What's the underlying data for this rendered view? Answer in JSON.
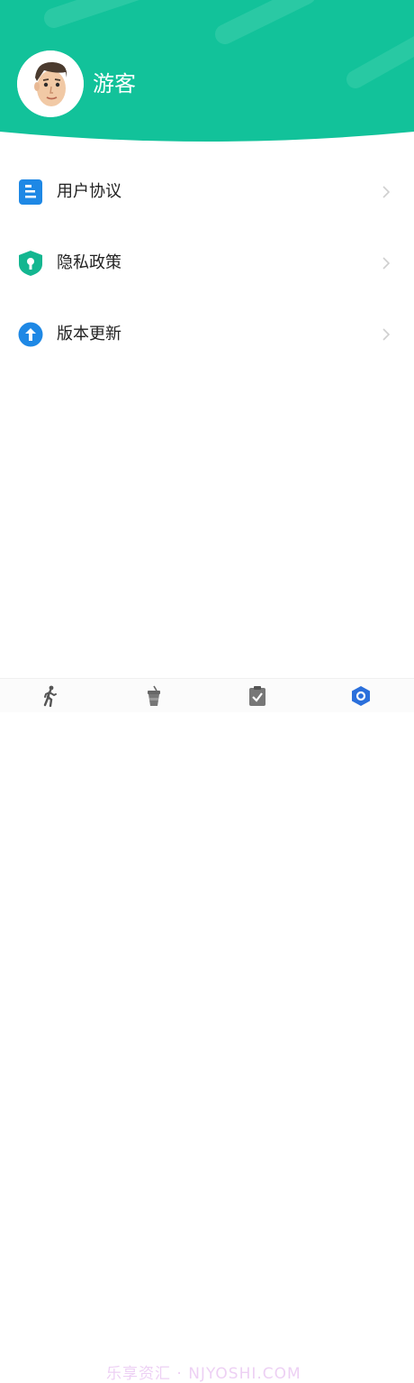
{
  "profile": {
    "username": "游客"
  },
  "menu": {
    "items": [
      {
        "label": "用户协议",
        "icon": "document-icon"
      },
      {
        "label": "隐私政策",
        "icon": "shield-icon"
      },
      {
        "label": "版本更新",
        "icon": "arrow-up-circle-icon"
      }
    ]
  },
  "bottom_nav": {
    "tabs": [
      {
        "icon": "walking-person-icon"
      },
      {
        "icon": "drink-cup-icon"
      },
      {
        "icon": "checklist-icon"
      },
      {
        "icon": "settings-hexagon-icon",
        "active": true
      }
    ]
  },
  "watermark": "乐享资汇 · NJYOSHI.COM",
  "colors": {
    "header": "#12c29a",
    "accent_blue": "#1e88e5",
    "shield": "#13b690",
    "active_tab": "#2a6fdb"
  }
}
